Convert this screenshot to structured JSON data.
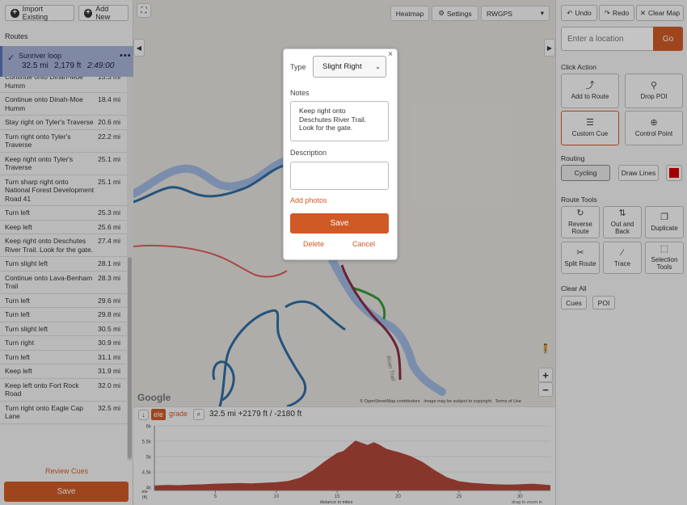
{
  "left_panel": {
    "import_label": "Import Existing",
    "add_new_label": "Add New",
    "routes_label": "Routes",
    "route": {
      "name": "Sunriver loop",
      "distance": "32.5 mi",
      "elevation": "2,179 ft",
      "time": "2:49:00",
      "more": "•••"
    },
    "cues": [
      {
        "text": "Continue onto Dinah-Moe Humm",
        "dist": "15.3 mi"
      },
      {
        "text": "Continue onto Dinah-Moe Humm",
        "dist": "18.4 mi"
      },
      {
        "text": "Stay right on Tyler's Traverse",
        "dist": "20.6 mi"
      },
      {
        "text": "Turn right onto Tyler's Traverse",
        "dist": "22.2 mi"
      },
      {
        "text": "Keep right onto Tyler's Traverse",
        "dist": "25.1 mi"
      },
      {
        "text": "Turn sharp right onto National Forest Development Road 41",
        "dist": "25.1 mi"
      },
      {
        "text": "Turn left",
        "dist": "25.3 mi"
      },
      {
        "text": "Keep left",
        "dist": "25.6 mi"
      },
      {
        "text": "Keep right onto Deschutes River Trail. Look for the gate.",
        "dist": "27.4 mi"
      },
      {
        "text": "Turn slight left",
        "dist": "28.1 mi"
      },
      {
        "text": "Continue onto Lava-Benham Trail",
        "dist": "28.3 mi"
      },
      {
        "text": "Turn left",
        "dist": "29.6 mi"
      },
      {
        "text": "Turn left",
        "dist": "29.8 mi"
      },
      {
        "text": "Turn slight left",
        "dist": "30.5 mi"
      },
      {
        "text": "Turn right",
        "dist": "30.9 mi"
      },
      {
        "text": "Turn left",
        "dist": "31.1 mi"
      },
      {
        "text": "Keep left",
        "dist": "31.9 mi"
      },
      {
        "text": "Keep left onto Fort Rock Road",
        "dist": "32.0 mi"
      },
      {
        "text": "Turn right onto Eagle Cap Lane",
        "dist": "32.5 mi"
      }
    ],
    "review_cues": "Review Cues",
    "save": "Save"
  },
  "map": {
    "heatmap": "Heatmap",
    "settings": "Settings",
    "layer": "RWGPS",
    "google": "Google",
    "attribution_osm": "© OpenStreetMap contributors",
    "attribution_image": "Image may be subject to copyright",
    "terms": "Terms of Use",
    "trail_label": "River Trail",
    "zoom_in": "+",
    "zoom_out": "−"
  },
  "popup": {
    "type_label": "Type",
    "type_value": "Slight Right",
    "type_options": [
      "Slight Right"
    ],
    "notes_label": "Notes",
    "notes_value": "Keep right onto Deschutes River Trail. Look for the gate.",
    "description_label": "Description",
    "description_value": "",
    "add_photos": "Add photos",
    "save": "Save",
    "delete": "Delete",
    "cancel": "Cancel",
    "close": "×"
  },
  "elevation": {
    "tab_ele": "ele",
    "tab_grade": "grade",
    "summary": "32.5 mi +2179 ft / -2180 ft",
    "y_ticks": [
      "6k",
      "5.5k",
      "5k",
      "4.5k",
      "4k"
    ],
    "y_axis_label": "ele\n(ft)",
    "x_ticks": [
      "5",
      "10",
      "15",
      "20",
      "25",
      "30"
    ],
    "x_label": "distance in miles",
    "drag_hint": "drag to zoom in",
    "profile": [
      [
        0,
        4060
      ],
      [
        1,
        4080
      ],
      [
        2,
        4070
      ],
      [
        3,
        4090
      ],
      [
        4,
        4100
      ],
      [
        5,
        4120
      ],
      [
        6,
        4130
      ],
      [
        7,
        4140
      ],
      [
        8,
        4130
      ],
      [
        9,
        4150
      ],
      [
        10,
        4170
      ],
      [
        11,
        4210
      ],
      [
        12,
        4320
      ],
      [
        13,
        4550
      ],
      [
        14,
        4850
      ],
      [
        15,
        5120
      ],
      [
        15.5,
        5180
      ],
      [
        16,
        5350
      ],
      [
        16.5,
        5520
      ],
      [
        17,
        5450
      ],
      [
        17.5,
        5380
      ],
      [
        18,
        5470
      ],
      [
        18.5,
        5380
      ],
      [
        19,
        5260
      ],
      [
        19.5,
        5200
      ],
      [
        20,
        5150
      ],
      [
        21,
        5020
      ],
      [
        22,
        4830
      ],
      [
        23,
        4560
      ],
      [
        24,
        4330
      ],
      [
        25,
        4200
      ],
      [
        26,
        4150
      ],
      [
        27,
        4120
      ],
      [
        28,
        4100
      ],
      [
        29,
        4090
      ],
      [
        30,
        4100
      ],
      [
        31,
        4120
      ],
      [
        32,
        4090
      ],
      [
        32.5,
        4070
      ]
    ],
    "x_max": 32.5,
    "y_min": 3900,
    "y_max": 6000
  },
  "right_panel": {
    "undo": "Undo",
    "redo": "Redo",
    "clear_map": "Clear Map",
    "location_placeholder": "Enter a location",
    "go": "Go",
    "click_action": "Click Action",
    "actions": [
      "Add to Route",
      "Drop POI",
      "Custom Cue",
      "Control Point"
    ],
    "routing": "Routing",
    "cycling": "Cycling",
    "draw_lines": "Draw Lines",
    "route_color": "#d10000",
    "route_tools": "Route Tools",
    "tools": [
      "Reverse Route",
      "Out and Back",
      "Duplicate",
      "Split Route",
      "Trace",
      "Selection Tools"
    ],
    "clear_all": "Clear All",
    "clear_cues": "Cues",
    "clear_poi": "POI"
  },
  "colors": {
    "accent": "#cf5a26",
    "route_selected_bg": "#a7b3d6",
    "elevation_fill": "#b0473a",
    "route_line": "#2e6da4",
    "river": "#9fb8e0",
    "route_pink": "#e05a5a",
    "active_track": "#8b2a46"
  }
}
